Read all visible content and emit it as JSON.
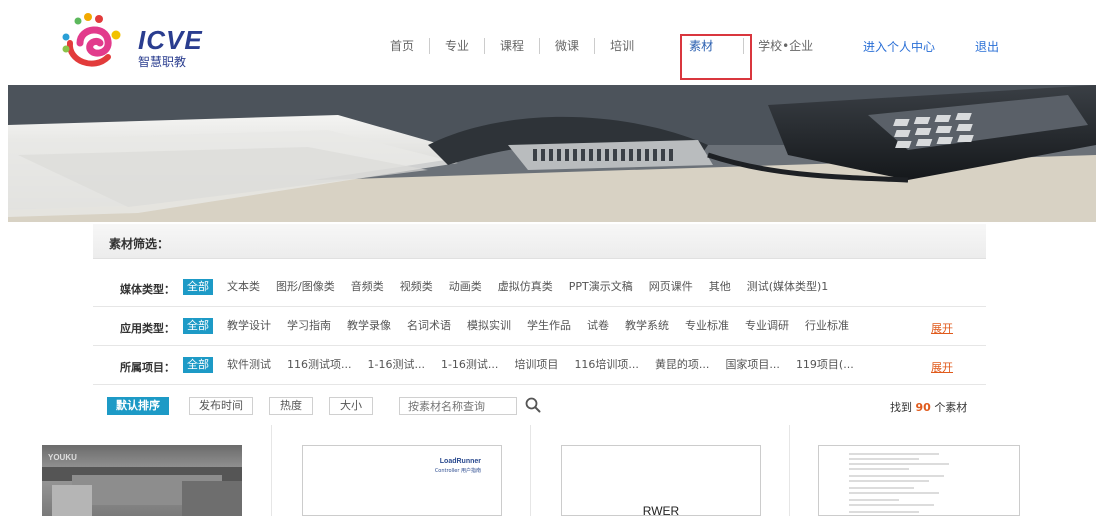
{
  "header": {
    "logo_text": "ICVE",
    "logo_sub": "智慧职教",
    "nav": [
      {
        "label": "首页"
      },
      {
        "label": "专业"
      },
      {
        "label": "课程"
      },
      {
        "label": "微课"
      },
      {
        "label": "培训"
      },
      {
        "label": "素材"
      },
      {
        "label": "学校•企业"
      }
    ],
    "active_nav": "素材",
    "personal_center": "进入个人中心",
    "logout": "退出"
  },
  "filters": {
    "title": "素材筛选：",
    "rows": [
      {
        "label": "媒体类型：",
        "all": "全部",
        "options": [
          "文本类",
          "图形/图像类",
          "音频类",
          "视频类",
          "动画类",
          "虚拟仿真类",
          "PPT演示文稿",
          "网页课件",
          "其他",
          "测试(媒体类型)1"
        ],
        "expand": ""
      },
      {
        "label": "应用类型：",
        "all": "全部",
        "options": [
          "教学设计",
          "学习指南",
          "教学录像",
          "名词术语",
          "模拟实训",
          "学生作品",
          "试卷",
          "教学系统",
          "专业标准",
          "专业调研",
          "行业标准"
        ],
        "expand": "展开"
      },
      {
        "label": "所属项目：",
        "all": "全部",
        "options": [
          "软件测试",
          "116测试项...",
          "1-16测试...",
          "1-16测试...",
          "培训项目",
          "116培训项...",
          "黄昆的项...",
          "国家项目...",
          "119项目(..."
        ],
        "expand": "展开"
      }
    ]
  },
  "sort": {
    "default": "默认排序",
    "publish_time": "发布时间",
    "popularity": "热度",
    "size": "大小",
    "search_placeholder": "按素材名称查询",
    "found_prefix": "找到",
    "found_count": "90",
    "found_suffix": "个素材"
  },
  "cards": [
    {
      "type": "video",
      "thumb_text": "YOUKU"
    },
    {
      "type": "document",
      "thumb_title": "LoadRunner",
      "thumb_sub": "Controller 用户指南"
    },
    {
      "type": "document",
      "thumb_text": "RWER"
    },
    {
      "type": "document"
    }
  ],
  "colors": {
    "accent": "#1d9ac6",
    "brand": "#2a3d8f",
    "link": "#2a6fd6",
    "highlight": "#d9363e",
    "expand": "#e05a1b"
  }
}
